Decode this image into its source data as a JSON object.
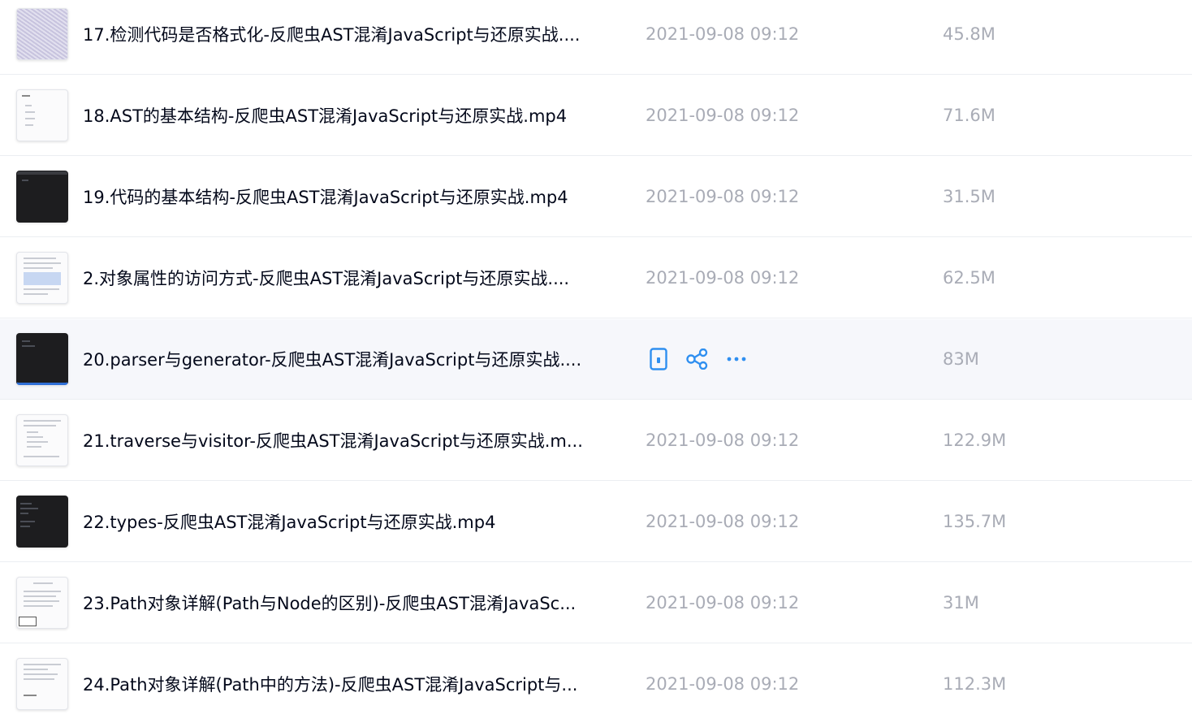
{
  "accent_color": "#2f8ff0",
  "files": [
    {
      "name": "17.检测代码是否格式化-反爬虫AST混淆JavaScript与还原实战....",
      "date": "2021-09-08 09:12",
      "size": "45.8M"
    },
    {
      "name": "18.AST的基本结构-反爬虫AST混淆JavaScript与还原实战.mp4",
      "date": "2021-09-08 09:12",
      "size": "71.6M"
    },
    {
      "name": "19.代码的基本结构-反爬虫AST混淆JavaScript与还原实战.mp4",
      "date": "2021-09-08 09:12",
      "size": "31.5M"
    },
    {
      "name": "2.对象属性的访问方式-反爬虫AST混淆JavaScript与还原实战....",
      "date": "2021-09-08 09:12",
      "size": "62.5M"
    },
    {
      "name": "20.parser与generator-反爬虫AST混淆JavaScript与还原实战....",
      "date": "",
      "size": "83M",
      "actions": [
        "phone-icon",
        "share-icon",
        "more-icon"
      ]
    },
    {
      "name": "21.traverse与visitor-反爬虫AST混淆JavaScript与还原实战.m...",
      "date": "2021-09-08 09:12",
      "size": "122.9M"
    },
    {
      "name": "22.types-反爬虫AST混淆JavaScript与还原实战.mp4",
      "date": "2021-09-08 09:12",
      "size": "135.7M"
    },
    {
      "name": "23.Path对象详解(Path与Node的区别)-反爬虫AST混淆JavaSc...",
      "date": "2021-09-08 09:12",
      "size": "31M"
    },
    {
      "name": "24.Path对象详解(Path中的方法)-反爬虫AST混淆JavaScript与...",
      "date": "2021-09-08 09:12",
      "size": "112.3M"
    }
  ]
}
